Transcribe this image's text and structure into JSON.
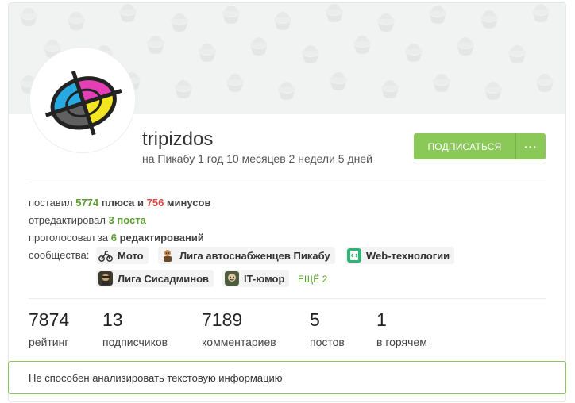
{
  "profile": {
    "username": "tripizdos",
    "since": "на Пикабу 1 год 10 месяцев 2 недели 5 дней",
    "subscribe_label": "ПОДПИСАТЬСЯ",
    "more_label": "···"
  },
  "stats": {
    "rated_prefix": "поставил ",
    "pluses": "5774",
    "pluses_word": " плюса и ",
    "minuses": "756",
    "minuses_word": " минусов",
    "edited_prefix": "отредактировал ",
    "edited_count": "3 поста",
    "voted_prefix": "проголосовал за ",
    "voted_count": "6",
    "voted_suffix": " редактирований"
  },
  "communities": {
    "label": "сообщества:",
    "items": [
      {
        "name": "Мото",
        "icon": "moto-icon"
      },
      {
        "name": "Лига автоснабженцев Пикабу",
        "icon": "auto-supply-icon"
      },
      {
        "name": "Web-технологии",
        "icon": "web-tech-icon"
      },
      {
        "name": "Лига Сисадминов",
        "icon": "sysadmin-icon"
      },
      {
        "name": "IT-юмор",
        "icon": "it-humor-icon"
      }
    ],
    "more": "ЕЩЁ 2"
  },
  "counters": [
    {
      "value": "7874",
      "label": "рейтинг"
    },
    {
      "value": "13",
      "label": "подписчиков"
    },
    {
      "value": "7189",
      "label": "комментариев"
    },
    {
      "value": "5",
      "label": "постов"
    },
    {
      "value": "1",
      "label": "в горячем"
    }
  ],
  "note": {
    "text": "Не способен анализировать текстовую информацию"
  },
  "colors": {
    "accent_green": "#8ac858",
    "plus_green": "#5a9e2c",
    "minus_red": "#e54444"
  }
}
